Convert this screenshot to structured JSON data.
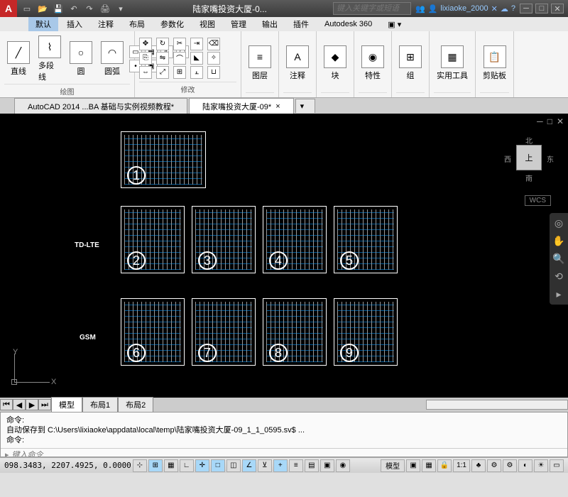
{
  "titlebar": {
    "app_letter": "A",
    "doc_title": "陆家嘴投资大厦-0...",
    "search_placeholder": "键入关键字或短语",
    "username": "lixiaoke_2000"
  },
  "menubar": {
    "items": [
      "默认",
      "插入",
      "注释",
      "布局",
      "参数化",
      "视图",
      "管理",
      "输出",
      "插件",
      "Autodesk 360"
    ]
  },
  "ribbon": {
    "draw": {
      "label": "绘图",
      "line": "直线",
      "pline": "多段线",
      "circle": "圆",
      "arc": "圆弧"
    },
    "modify": {
      "label": "修改"
    },
    "layer": {
      "label": "图层"
    },
    "annot": {
      "label": "注释"
    },
    "block": {
      "label": "块"
    },
    "prop": {
      "label": "特性"
    },
    "group": {
      "label": "组"
    },
    "util": {
      "label": "实用工具"
    },
    "clip": {
      "label": "剪贴板"
    }
  },
  "doc_tabs": {
    "tab1": "AutoCAD 2014 ...BA 基础与实例视频教程*",
    "tab2": "陆家嘴投资大厦-09*"
  },
  "canvas": {
    "row1_label": "TD-LTE",
    "row2_label": "GSM",
    "cube_top": "上",
    "cube_n": "北",
    "cube_s": "南",
    "cube_e": "东",
    "cube_w": "西",
    "wcs": "WCS",
    "ucs_y": "Y",
    "ucs_x": "X"
  },
  "layout": {
    "model": "模型",
    "l1": "布局1",
    "l2": "布局2"
  },
  "cmd": {
    "line1": "命令:",
    "line2": "自动保存到 C:\\Users\\lixiaoke\\appdata\\local\\temp\\陆家嘴投资大厦-09_1_1_0595.sv$ ...",
    "line3": "命令:",
    "prompt_icon": "▸",
    "placeholder": "键入命令"
  },
  "status": {
    "coords": "098.3483, 2207.4925, 0.0000",
    "model": "模型",
    "scale": "1:1"
  }
}
